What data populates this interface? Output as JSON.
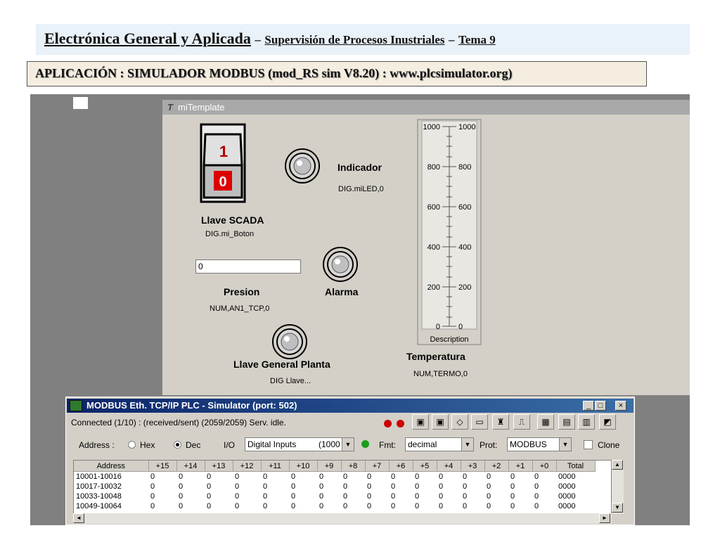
{
  "slide": {
    "title_main": "Electrónica General y Aplicada",
    "title_dash": "–",
    "title_sub": "Supervisión de Procesos Inustriales",
    "title_dash2": "–",
    "title_topic": "Tema 9",
    "subtitle": "APLICACIÓN : SIMULADOR MODBUS (mod_RS sim V8.20) : www.plcsimulator.org)"
  },
  "template_window": {
    "title": "miTemplate",
    "switch": {
      "label": "Llave SCADA",
      "tag": "DIG.mi_Boton",
      "top_glyph": "1",
      "bottom_glyph": "0"
    },
    "indicator": {
      "label": "Indicador",
      "tag": "DIG.miLED,0"
    },
    "pressure": {
      "label": "Presion",
      "tag": "NUM,AN1_TCP,0",
      "value": "0"
    },
    "alarm": {
      "label": "Alarma"
    },
    "plant_key": {
      "label": "Llave General Planta",
      "tag": "DIG Llave..."
    },
    "gauge": {
      "label": "Temperatura",
      "tag": "NUM,TERMO,0",
      "description": "Description",
      "scale": [
        "1000",
        "800",
        "600",
        "400",
        "200",
        "0"
      ]
    }
  },
  "simulator": {
    "title": "MODBUS Eth. TCP/IP PLC - Simulator (port: 502)",
    "window_buttons": [
      "_",
      "□",
      "×"
    ],
    "status": "Connected (1/10) : (received/sent) (2059/2059) Serv. idle.",
    "address_label": "Address :",
    "hex_label": "Hex",
    "dec_label": "Dec",
    "address_mode": "Dec",
    "io_label": "I/O",
    "io_value": "Digital Inputs",
    "io_range": "(1000",
    "fmt_label": "Fmt:",
    "fmt_value": "decimal",
    "prot_label": "Prot:",
    "prot_value": "MODBUS",
    "clone_label": "Clone",
    "clone_checked": false,
    "indicator_colors": {
      "red": "#cc0000",
      "green": "#1a9e1a"
    },
    "table": {
      "headers": [
        "Address",
        "+15",
        "+14",
        "+13",
        "+12",
        "+11",
        "+10",
        "+9",
        "+8",
        "+7",
        "+6",
        "+5",
        "+4",
        "+3",
        "+2",
        "+1",
        "+0",
        "Total"
      ],
      "rows": [
        [
          "10001-10016",
          "0",
          "0",
          "0",
          "0",
          "0",
          "0",
          "0",
          "0",
          "0",
          "0",
          "0",
          "0",
          "0",
          "0",
          "0",
          "0",
          "0000"
        ],
        [
          "10017-10032",
          "0",
          "0",
          "0",
          "0",
          "0",
          "0",
          "0",
          "0",
          "0",
          "0",
          "0",
          "0",
          "0",
          "0",
          "0",
          "0",
          "0000"
        ],
        [
          "10033-10048",
          "0",
          "0",
          "0",
          "0",
          "0",
          "0",
          "0",
          "0",
          "0",
          "0",
          "0",
          "0",
          "0",
          "0",
          "0",
          "0",
          "0000"
        ],
        [
          "10049-10064",
          "0",
          "0",
          "0",
          "0",
          "0",
          "0",
          "0",
          "0",
          "0",
          "0",
          "0",
          "0",
          "0",
          "0",
          "0",
          "0",
          "0000"
        ]
      ]
    }
  }
}
